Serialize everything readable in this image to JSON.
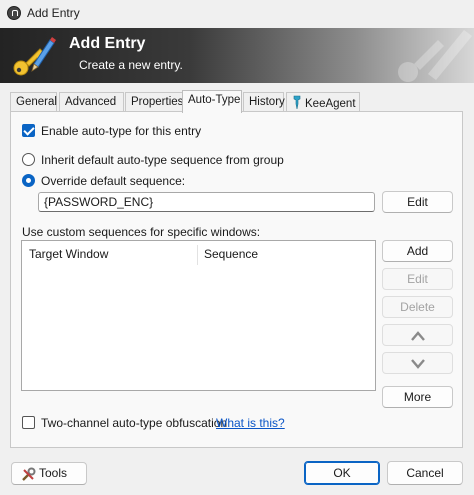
{
  "window": {
    "title": "Add Entry"
  },
  "banner": {
    "title": "Add Entry",
    "subtitle": "Create a new entry."
  },
  "tabs": [
    {
      "label": "General"
    },
    {
      "label": "Advanced"
    },
    {
      "label": "Properties"
    },
    {
      "label": "Auto-Type",
      "active": true
    },
    {
      "label": "History"
    },
    {
      "label": "KeeAgent"
    }
  ],
  "autotype": {
    "enable_label": "Enable auto-type for this entry",
    "enable_checked": true,
    "inherit_label": "Inherit default auto-type sequence from group",
    "override_label": "Override default sequence:",
    "override_selected": true,
    "sequence_value": "{PASSWORD_ENC}",
    "edit_label": "Edit",
    "custom_label": "Use custom sequences for specific windows:",
    "columns": [
      "Target Window",
      "Sequence"
    ],
    "rows": [],
    "add_label": "Add",
    "row_edit_label": "Edit",
    "delete_label": "Delete",
    "more_label": "More",
    "obfuscation_label": "Two-channel auto-type obfuscation",
    "obfuscation_checked": false,
    "whatis_label": "What is this?"
  },
  "footer": {
    "tools_label": "Tools",
    "ok_label": "OK",
    "cancel_label": "Cancel"
  },
  "colors": {
    "accent": "#0a64c4",
    "link": "#0a55c7"
  },
  "icons": {
    "app": "keepass-lock-icon",
    "banner": "pen-key-icon",
    "tools": "tools-icon"
  }
}
